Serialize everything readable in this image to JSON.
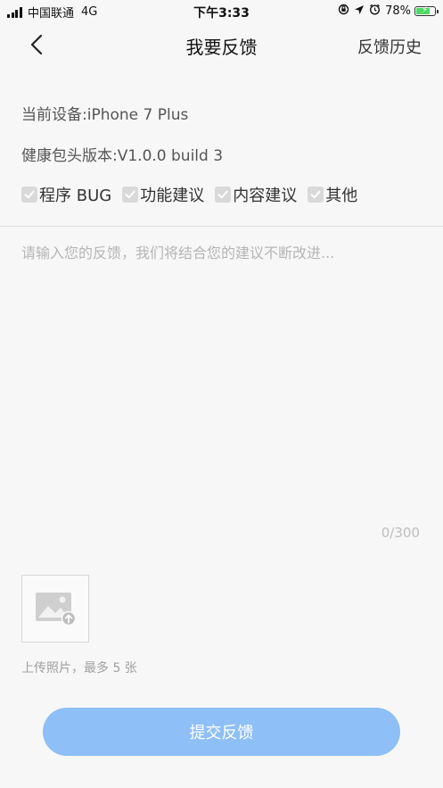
{
  "status_bar": {
    "carrier": "中国联通",
    "network": "4G",
    "time": "下午3:33",
    "battery": "78%",
    "battery_level": 0.78,
    "icons": [
      "orientation-lock-icon",
      "location-icon",
      "alarm-icon"
    ]
  },
  "nav": {
    "title": "我要反馈",
    "history_label": "反馈历史",
    "back_icon": "chevron-left-icon"
  },
  "info": {
    "device_label": "当前设备:iPhone 7 Plus",
    "version_label": "健康包头版本:V1.0.0 build 3"
  },
  "feedback_types": [
    {
      "label": "程序 BUG"
    },
    {
      "label": "功能建议"
    },
    {
      "label": "内容建议"
    },
    {
      "label": "其他"
    }
  ],
  "feedback": {
    "placeholder": "请输入您的反馈，我们将结合您的建议不断改进...",
    "value": "",
    "counter": "0/300"
  },
  "upload": {
    "icon": "image-upload-icon",
    "hint": "上传照片，最多 5 张"
  },
  "submit_label": "提交反馈",
  "colors": {
    "background": "#f7f7f7",
    "submit_bg": "#8ebff6",
    "checkbox_bg": "#d9d9d9"
  }
}
